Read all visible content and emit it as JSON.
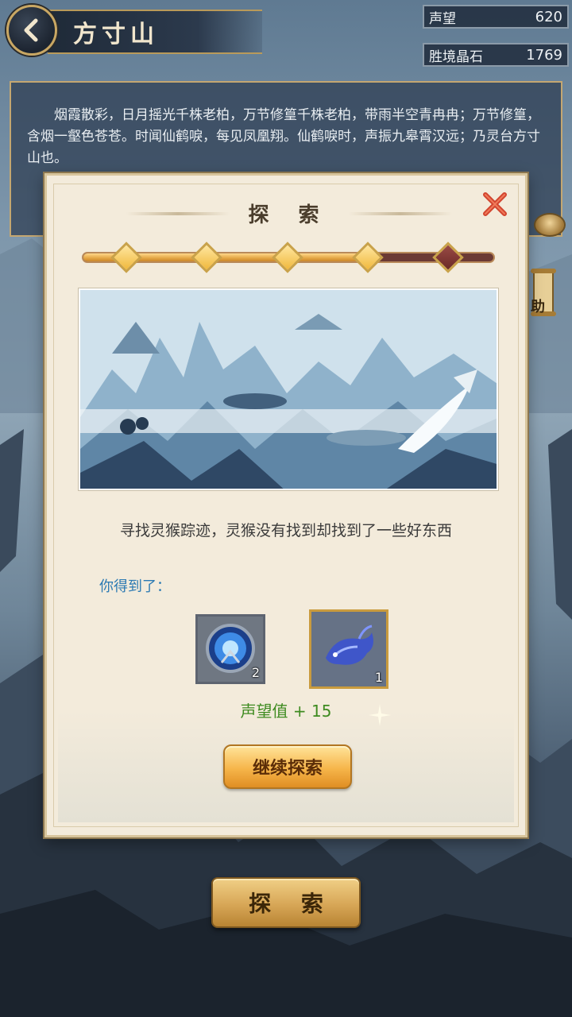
{
  "header": {
    "location_title": "方寸山",
    "resources": [
      {
        "label": "声望",
        "value": "620"
      },
      {
        "label": "胜境晶石",
        "value": "1769"
      }
    ]
  },
  "description": "烟霞散彩，日月摇光千株老柏，万节修篁千株老柏，带雨半空青冉冉；万节修篁，含烟一壑色苍苍。时闻仙鹤唳，每见凤凰翔。仙鹤唳时，声振九皋霄汉远；乃灵台方寸山也。",
  "modal": {
    "title": "探 索",
    "progress": {
      "completed_steps": 4,
      "total_steps": 5
    },
    "event_text": "寻找灵猴踪迹，灵猴没有找到却找到了一些好东西",
    "reward_label": "你得到了：",
    "rewards": [
      {
        "icon": "blue-orb-icon",
        "count": "2"
      },
      {
        "icon": "spirit-fish-icon",
        "count": "1"
      }
    ],
    "reputation_gain": "声望值 + 15",
    "continue_button": "继续探索"
  },
  "bottom": {
    "explore_button": "探 索",
    "side_help_label": "助"
  },
  "colors": {
    "accent_gold": "#f6b54a",
    "reward_text": "#2c7ab3",
    "reputation_text": "#3e8b20",
    "progress_done": "#f0b83c",
    "progress_todo": "#6a2a26"
  }
}
